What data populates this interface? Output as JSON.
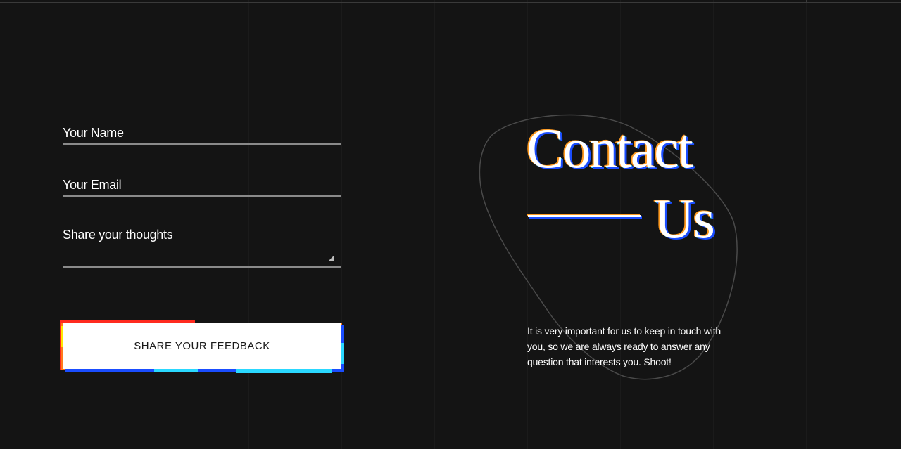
{
  "form": {
    "name_placeholder": "Your Name",
    "email_placeholder": "Your Email",
    "thoughts_placeholder": "Share your thoughts",
    "submit_label": "SHARE YOUR FEEDBACK"
  },
  "contact": {
    "title_line1": "Contact",
    "title_line2": "Us",
    "description": "It is very important for us to keep in touch with you, so we are always ready to answer any question that interests you. Shoot!"
  },
  "colors": {
    "background": "#141414",
    "text": "#ffffff",
    "field_underline": "#8a8a8a",
    "button_bg": "#ffffff",
    "glitch_orange": "#ff9a1f",
    "glitch_yellow": "#ffe600",
    "glitch_red": "#ff2a1f",
    "glitch_blue": "#1a4dff",
    "glitch_cyan": "#2ad8ff"
  }
}
